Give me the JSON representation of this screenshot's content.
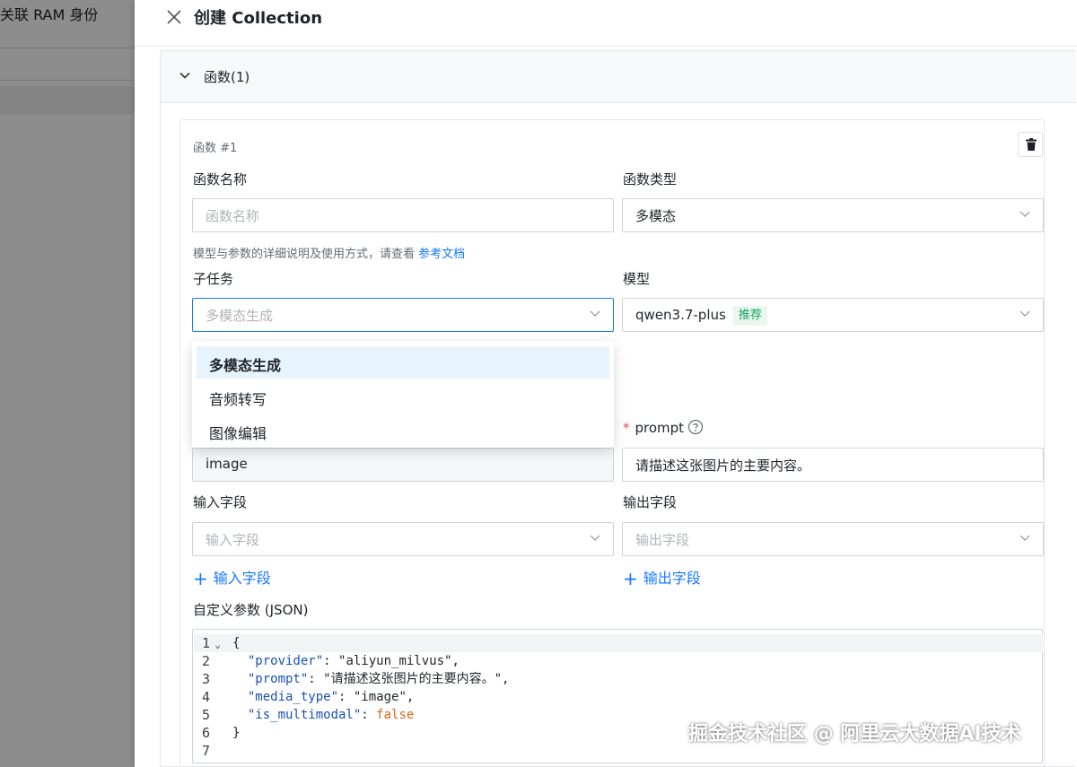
{
  "background": {
    "left_item_label": "关联 RAM 身份"
  },
  "drawer": {
    "title": "创建 Collection",
    "section_title": "函数(1)",
    "function_card": {
      "title": "函数 #1",
      "fields": {
        "function_name": {
          "label": "函数名称",
          "placeholder": "函数名称",
          "value": ""
        },
        "function_type": {
          "label": "函数类型",
          "value": "多模态"
        },
        "hint_text": "模型与参数的详细说明及使用方式，请查看",
        "hint_link": "参考文档",
        "subtask": {
          "label": "子任务",
          "placeholder": "多模态生成"
        },
        "model": {
          "label": "模型",
          "value": "qwen3.7-plus",
          "badge": "推荐"
        },
        "media_type": {
          "value": "image"
        },
        "prompt": {
          "label": "prompt",
          "required_mark": "*",
          "value": "请描述这张图片的主要内容。"
        },
        "input_field": {
          "label": "输入字段",
          "placeholder": "输入字段",
          "add_label": "输入字段"
        },
        "output_field": {
          "label": "输出字段",
          "placeholder": "输出字段",
          "add_label": "输出字段"
        },
        "custom_params": {
          "label": "自定义参数 (JSON)"
        }
      },
      "subtask_options": [
        {
          "label": "多模态生成",
          "selected": true
        },
        {
          "label": "音频转写",
          "selected": false
        },
        {
          "label": "图像编辑",
          "selected": false
        }
      ],
      "json_editor": {
        "line_numbers": [
          "1",
          "2",
          "3",
          "4",
          "5",
          "6",
          "7"
        ],
        "lines": [
          {
            "open": "{"
          },
          {
            "key": "\"provider\"",
            "sep": ": ",
            "str": "\"aliyun_milvus\"",
            "end": ","
          },
          {
            "key": "\"prompt\"",
            "sep": ": ",
            "str": "\"请描述这张图片的主要内容。\"",
            "end": ","
          },
          {
            "key": "\"media_type\"",
            "sep": ": ",
            "str": "\"image\"",
            "end": ","
          },
          {
            "key": "\"is_multimodal\"",
            "sep": ": ",
            "bool": "false"
          },
          {
            "close": "}"
          },
          {
            "empty": ""
          }
        ]
      }
    }
  },
  "watermark": "掘金技术社区 @ 阿里云大数据AI技术",
  "colors": {
    "accent": "#1677ff",
    "badge_green": "#1aa35b",
    "required_red": "#f54a45",
    "json_key": "#1a4fb5",
    "json_bool": "#e0661b"
  }
}
